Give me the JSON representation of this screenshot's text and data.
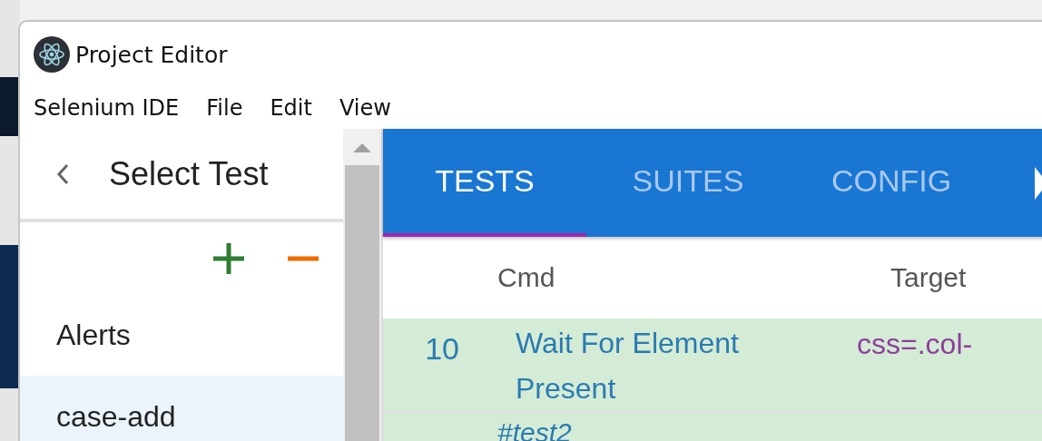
{
  "window": {
    "title": "Project Editor"
  },
  "menu": [
    {
      "label": "Selenium IDE"
    },
    {
      "label": "File"
    },
    {
      "label": "Edit"
    },
    {
      "label": "View"
    }
  ],
  "sidebar": {
    "title": "Select Test",
    "items": [
      {
        "label": "Alerts",
        "selected": false
      },
      {
        "label": "case-add",
        "selected": true
      }
    ]
  },
  "tabs": [
    {
      "label": "TESTS",
      "selected": true
    },
    {
      "label": "SUITES",
      "selected": false
    },
    {
      "label": "CONFIG",
      "selected": false
    }
  ],
  "table": {
    "columns": [
      "Cmd",
      "Target"
    ],
    "rows": [
      {
        "kind": "command",
        "index": "10",
        "command": "Wait For Element Present",
        "target": "css=.col-"
      },
      {
        "kind": "comment",
        "text": "#test2"
      }
    ]
  }
}
